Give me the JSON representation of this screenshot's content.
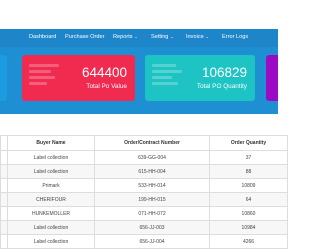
{
  "nav": {
    "items": [
      {
        "label": "Dashboard",
        "has_menu": false
      },
      {
        "label": "Purchase Order",
        "has_menu": false
      },
      {
        "label": "Reports",
        "has_menu": true
      },
      {
        "label": "Setting",
        "has_menu": true
      },
      {
        "label": "Invoice",
        "has_menu": true
      },
      {
        "label": "Error Logs",
        "has_menu": false
      }
    ]
  },
  "cards": {
    "po_value": {
      "value": "644400",
      "label": "Total Po Value",
      "color": "#f12a50"
    },
    "po_quantity": {
      "value": "106829",
      "label": "Total PO Quantity",
      "color": "#1dc4c3"
    },
    "left_partial_color": "#1b9ce0",
    "right_partial_color": "#9c0bc4"
  },
  "colors": {
    "navbar": "#1e86c8",
    "header_area": "#1f8fd3"
  },
  "table": {
    "columns": [
      "",
      "Buyer Name",
      "Order/Contract Number",
      "Order Quantity"
    ],
    "rows": [
      [
        "",
        "Label collection",
        "639-GG-004",
        "37"
      ],
      [
        "",
        "Label collection",
        "615-HH-004",
        "88"
      ],
      [
        "",
        "Primark",
        "533-HH-014",
        "10809"
      ],
      [
        "",
        "CHERIFOUR",
        "199-HH-015",
        "64"
      ],
      [
        "",
        "HUNKEMOLLER",
        "071-HH-072",
        "10860"
      ],
      [
        "",
        "Label collection",
        "656-JJ-003",
        "10984"
      ],
      [
        "",
        "Label collection",
        "656-JJ-004",
        "4266"
      ]
    ]
  }
}
